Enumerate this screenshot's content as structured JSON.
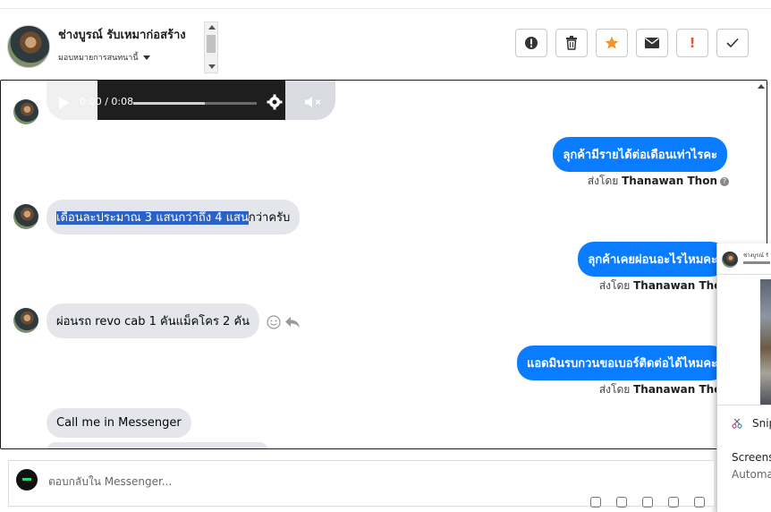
{
  "header": {
    "contact_name": "ช่างบูรณ์ รับเหมาก่อสร้าง",
    "assign_label": "มอบหมายการสนทนานี้",
    "actions": [
      {
        "name": "report-icon",
        "color": "#333333"
      },
      {
        "name": "trash-icon",
        "color": "#333333"
      },
      {
        "name": "star-icon",
        "color": "#f5922e"
      },
      {
        "name": "envelope-icon",
        "color": "#333333"
      },
      {
        "name": "exclamation-icon",
        "color": "#e4572e",
        "glyph": "!"
      },
      {
        "name": "check-icon",
        "color": "#333333"
      }
    ]
  },
  "audio": {
    "time": "0:00 / 0:08",
    "progress": 0.58
  },
  "messages": {
    "out1": {
      "text": "ลุกค้ามีรายได้ต่อเดือนเท่าไรคะ",
      "sent_by_label": "ส่งโดย",
      "sender": "Thanawan Thon"
    },
    "in1": {
      "highlighted": "เดือนละประมาณ 3 แสนกว่าถึง 4 แสน",
      "rest": "กว่าครับ"
    },
    "out2": {
      "text": "ลุกค้าเคยผ่อนอะไรไหมคะ",
      "sent_by_label": "ส่งโดย",
      "sender": "Thanawan Thon"
    },
    "in2": {
      "text": "ผ่อนรถ revo cab 1 คันแม็คโคร 2 คัน"
    },
    "out3": {
      "text": "แอดมินรบกวนขอเบอร์ติดต่อได้ไหมคะ",
      "sent_by_label": "ส่งโดย",
      "sender": "Thanawan Thon"
    },
    "in3": {
      "text": "Call me in Messenger"
    }
  },
  "popup": {
    "title": "ช่างบูรณ์ รั",
    "snip": "Snip",
    "screens": "Screens",
    "automa": "Automa"
  },
  "composer": {
    "placeholder": "ตอบกลับใน Messenger..."
  },
  "colors": {
    "outgoing_bubble": "#0a7cff",
    "incoming_bubble": "#e4e6eb",
    "highlight": "#2a62c9"
  }
}
